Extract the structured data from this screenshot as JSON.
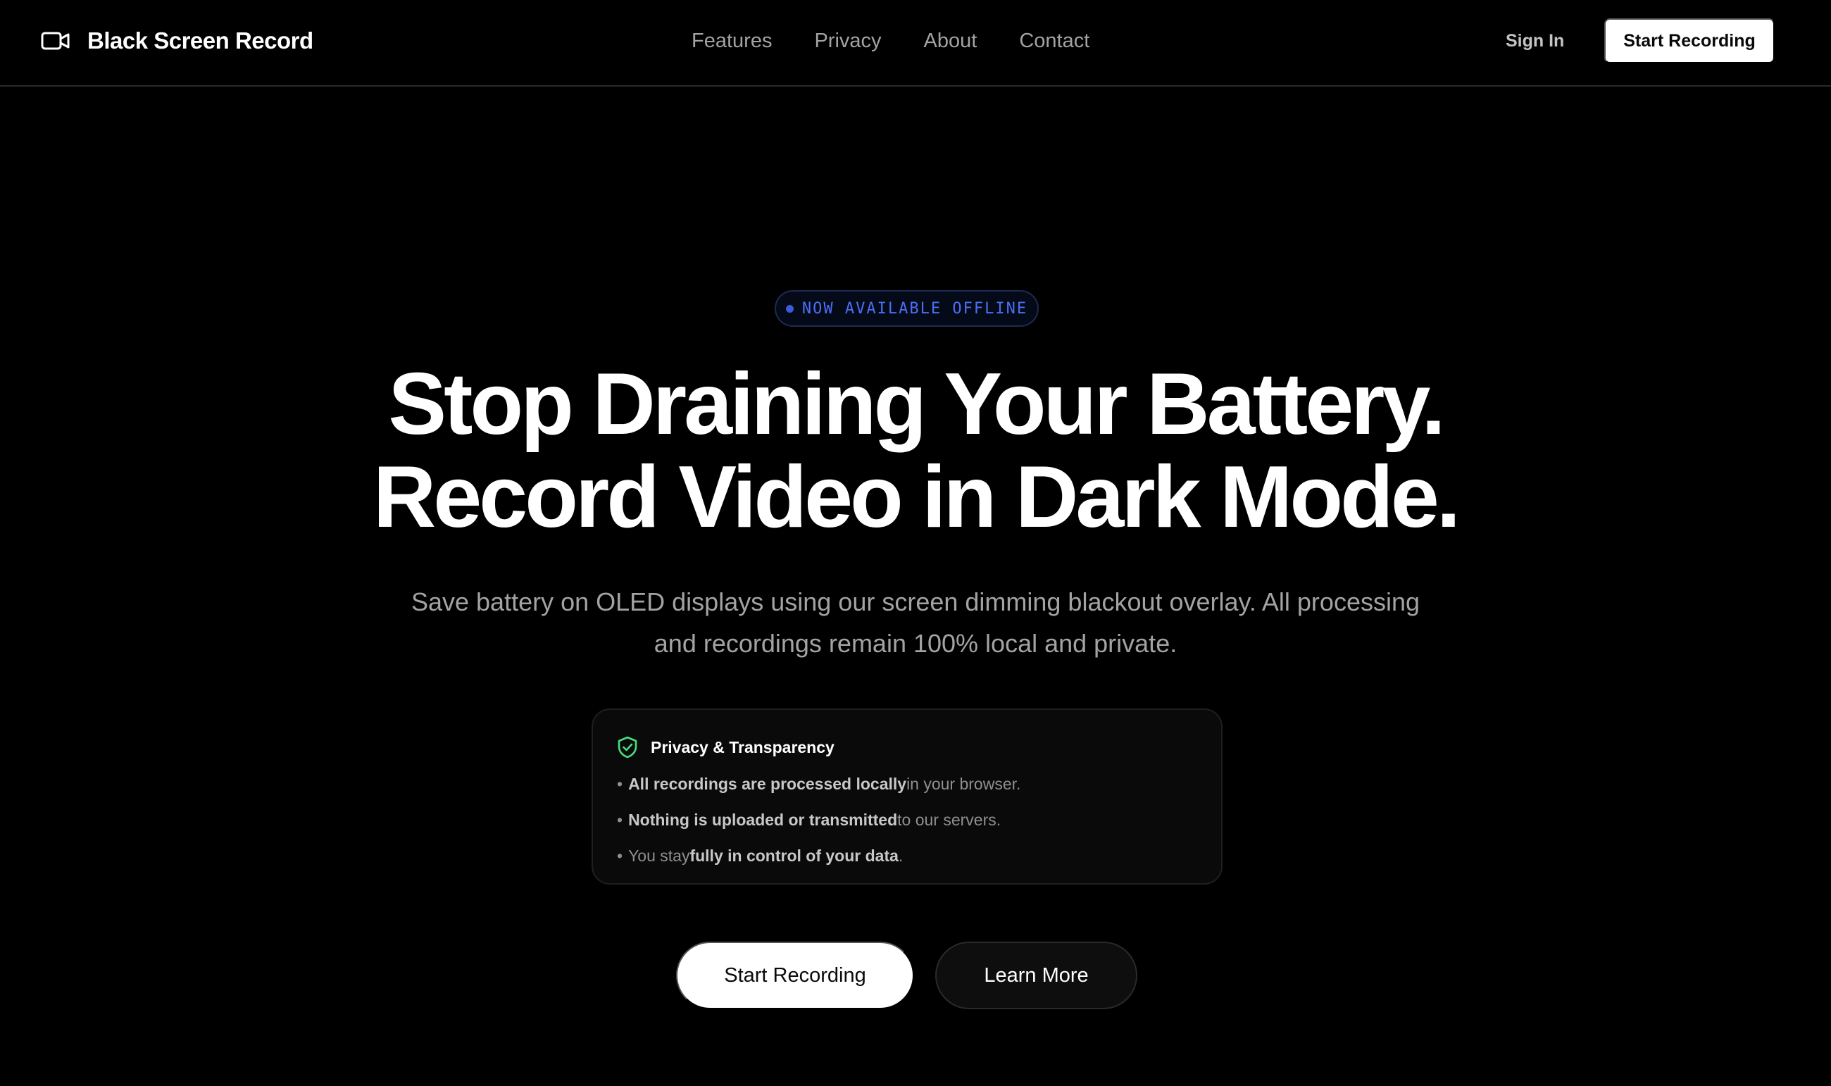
{
  "header": {
    "brand_name": "Black Screen Record",
    "brand_icon": "video-camera-icon",
    "nav": [
      {
        "label": "Features"
      },
      {
        "label": "Privacy"
      },
      {
        "label": "About"
      },
      {
        "label": "Contact"
      }
    ],
    "sign_in_label": "Sign In",
    "cta_label": "Start Recording"
  },
  "hero": {
    "badge_text": "NOW AVAILABLE OFFLINE",
    "headline_line1": "Stop Draining Your Battery.",
    "headline_line2": "Record Video in Dark Mode.",
    "subtitle": "Save battery on OLED displays using our screen dimming blackout overlay. All processing and recordings remain 100% local and private."
  },
  "privacy_card": {
    "icon": "shield-check-icon",
    "title": "Privacy & Transparency",
    "items": [
      {
        "pre": "",
        "bold": "All recordings are processed locally",
        "post": " in your browser."
      },
      {
        "pre": "",
        "bold": "Nothing is uploaded or transmitted",
        "post": " to our servers."
      },
      {
        "pre": "You stay ",
        "bold": "fully in control of your data",
        "post": "."
      }
    ]
  },
  "actions": {
    "primary_label": "Start Recording",
    "secondary_label": "Learn More"
  },
  "colors": {
    "background": "#000000",
    "badge_accent": "#4c6ef5",
    "shield_accent": "#4ade80",
    "muted_text": "#a3a3a3"
  }
}
